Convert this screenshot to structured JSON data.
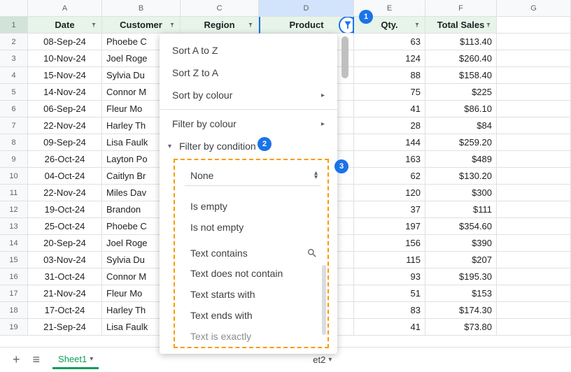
{
  "columns": [
    "A",
    "B",
    "C",
    "D",
    "E",
    "F",
    "G"
  ],
  "rows_visible": 19,
  "headers": {
    "A": "Date",
    "B": "Customer",
    "C": "Region",
    "D": "Product",
    "E": "Qty.",
    "F": "Total Sales"
  },
  "data": [
    {
      "n": 2,
      "date": "08-Sep-24",
      "cust": "Phoebe C",
      "qty": "63",
      "total": "$113.40"
    },
    {
      "n": 3,
      "date": "10-Nov-24",
      "cust": "Joel Roge",
      "qty": "124",
      "total": "$260.40"
    },
    {
      "n": 4,
      "date": "15-Nov-24",
      "cust": "Sylvia Du",
      "qty": "88",
      "total": "$158.40"
    },
    {
      "n": 5,
      "date": "14-Nov-24",
      "cust": "Connor M",
      "qty": "75",
      "total": "$225"
    },
    {
      "n": 6,
      "date": "06-Sep-24",
      "cust": "Fleur Mo",
      "qty": "41",
      "total": "$86.10"
    },
    {
      "n": 7,
      "date": "22-Nov-24",
      "cust": "Harley Th",
      "qty": "28",
      "total": "$84"
    },
    {
      "n": 8,
      "date": "09-Sep-24",
      "cust": "Lisa Faulk",
      "qty": "144",
      "total": "$259.20"
    },
    {
      "n": 9,
      "date": "26-Oct-24",
      "cust": "Layton Po",
      "qty": "163",
      "total": "$489"
    },
    {
      "n": 10,
      "date": "04-Oct-24",
      "cust": "Caitlyn Br",
      "qty": "62",
      "total": "$130.20"
    },
    {
      "n": 11,
      "date": "22-Nov-24",
      "cust": "Miles Dav",
      "qty": "120",
      "total": "$300"
    },
    {
      "n": 12,
      "date": "19-Oct-24",
      "cust": "Brandon",
      "qty": "37",
      "total": "$111"
    },
    {
      "n": 13,
      "date": "25-Oct-24",
      "cust": "Phoebe C",
      "qty": "197",
      "total": "$354.60"
    },
    {
      "n": 14,
      "date": "20-Sep-24",
      "cust": "Joel Roge",
      "qty": "156",
      "total": "$390"
    },
    {
      "n": 15,
      "date": "03-Nov-24",
      "cust": "Sylvia Du",
      "qty": "115",
      "total": "$207"
    },
    {
      "n": 16,
      "date": "31-Oct-24",
      "cust": "Connor M",
      "qty": "93",
      "total": "$195.30"
    },
    {
      "n": 17,
      "date": "21-Nov-24",
      "cust": "Fleur Mo",
      "qty": "51",
      "total": "$153"
    },
    {
      "n": 18,
      "date": "17-Oct-24",
      "cust": "Harley Th",
      "qty": "83",
      "total": "$174.30"
    },
    {
      "n": 19,
      "date": "21-Sep-24",
      "cust": "Lisa Faulk",
      "qty": "41",
      "total": "$73.80"
    }
  ],
  "menu": {
    "sort_az": "Sort A to Z",
    "sort_za": "Sort Z to A",
    "sort_colour": "Sort by colour",
    "filter_colour": "Filter by colour",
    "filter_condition": "Filter by condition"
  },
  "condition_selected": "None",
  "condition_options": [
    "Is empty",
    "Is not empty",
    "Text contains",
    "Text does not contain",
    "Text starts with",
    "Text ends with",
    "Text is exactly"
  ],
  "badges": {
    "b1": "1",
    "b2": "2",
    "b3": "3"
  },
  "sheets": {
    "s1": "Sheet1",
    "s2": "et2"
  },
  "icons": {
    "plus": "+",
    "menu": "≡",
    "caret": "▾",
    "arrow": "▸",
    "updown": "▴▾"
  }
}
